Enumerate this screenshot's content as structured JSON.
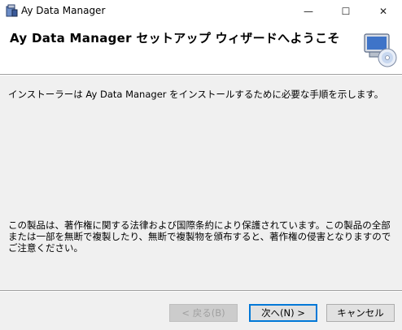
{
  "window": {
    "title": "Ay Data Manager",
    "minimize_glyph": "—",
    "maximize_glyph": "☐",
    "close_glyph": "✕"
  },
  "header": {
    "title": "Ay Data Manager セットアップ ウィザードへようこそ"
  },
  "body": {
    "intro": "インストーラーは Ay Data Manager をインストールするために必要な手順を示します。",
    "copyright": "この製品は、著作権に関する法律および国際条約により保護されています。この製品の全部または一部を無断で複製したり、無断で複製物を頒布すると、著作権の侵害となりますのでご注意ください。"
  },
  "buttons": {
    "back": "< 戻る(B)",
    "next": "次へ(N) >",
    "cancel": "キャンセル"
  },
  "icons": {
    "app": "installer-icon",
    "header": "computer-cd-icon"
  },
  "colors": {
    "accent": "#0078d7",
    "background": "#f0f0f0"
  }
}
